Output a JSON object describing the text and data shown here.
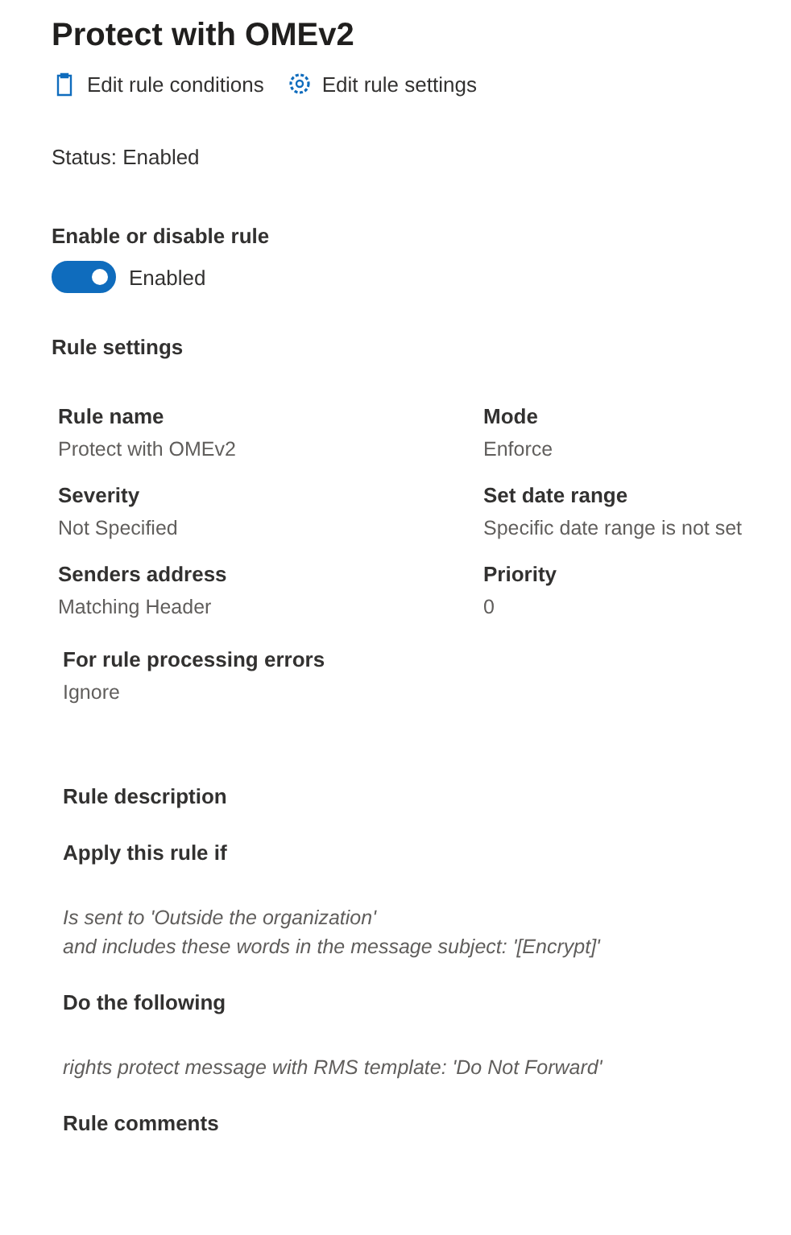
{
  "title": "Protect with OMEv2",
  "actions": [
    {
      "kind": "clipboard",
      "label": "Edit rule conditions"
    },
    {
      "kind": "gear",
      "label": "Edit rule settings"
    }
  ],
  "status": "Status: Enabled",
  "toggle": {
    "label": "Enable or disable rule",
    "on": true,
    "state_label": "Enabled"
  },
  "rule_settings": {
    "heading": "Rule settings",
    "fields": [
      {
        "label": "Rule name",
        "value": "Protect with OMEv2"
      },
      {
        "label": "Mode",
        "value": "Enforce"
      },
      {
        "label": "Severity",
        "value": "Not Specified"
      },
      {
        "label": "Set date range",
        "value": "Specific date range is not set"
      },
      {
        "label": "Senders address",
        "value": "Matching Header"
      },
      {
        "label": "Priority",
        "value": "0"
      }
    ]
  },
  "processing_errors": {
    "label": "For rule processing errors",
    "value": "Ignore"
  },
  "rule_description": {
    "heading": "Rule description",
    "conditions_heading": "Apply this rule if",
    "conditions": [
      "Is sent to 'Outside the organization'",
      "and includes these words in the message subject: '[Encrypt]'"
    ],
    "actions_heading": "Do the following",
    "actions": [
      "rights protect message with RMS template:  'Do Not Forward'"
    ]
  },
  "comments_heading": "Rule comments"
}
